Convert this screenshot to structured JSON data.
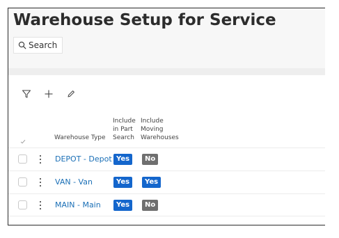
{
  "page": {
    "title": "Warehouse Setup for Service"
  },
  "search": {
    "label": "Search"
  },
  "toolbar": {
    "icons": [
      "filter-icon",
      "plus-icon",
      "pencil-icon"
    ]
  },
  "table": {
    "columns": {
      "warehouse_type": "Warehouse Type",
      "part_search": [
        "Include",
        "in Part",
        "Search"
      ],
      "moving": [
        "Include",
        "Moving",
        "Warehouses"
      ]
    },
    "rows": [
      {
        "warehouse_type": "DEPOT - Depot",
        "part_search": "Yes",
        "moving": "No"
      },
      {
        "warehouse_type": "VAN - Van",
        "part_search": "Yes",
        "moving": "Yes"
      },
      {
        "warehouse_type": "MAIN - Main",
        "part_search": "Yes",
        "moving": "No"
      }
    ]
  },
  "colors": {
    "yes_badge": "#1466cc",
    "no_badge": "#6f6f6f",
    "link": "#1a6fb6"
  }
}
